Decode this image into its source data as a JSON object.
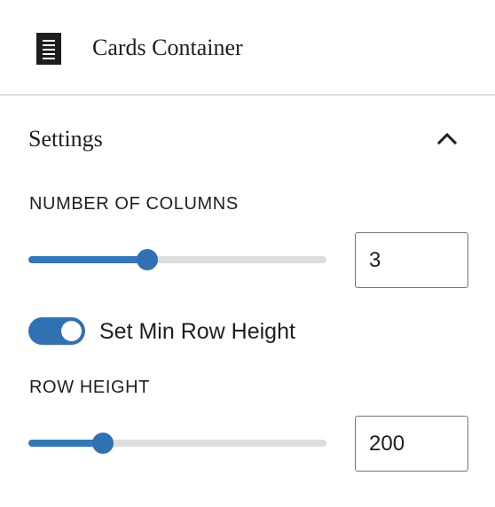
{
  "header": {
    "block_icon": "document-list-icon",
    "title": "Cards Container"
  },
  "panel": {
    "title": "Settings",
    "toggle_icon": "chevron-up-icon",
    "expanded": true
  },
  "columns": {
    "label": "NUMBER OF COLUMNS",
    "value": "3",
    "slider_fraction": 0.4
  },
  "min_row_height": {
    "label": "Set Min Row Height",
    "enabled": true
  },
  "row_height": {
    "label": "ROW HEIGHT",
    "value": "200",
    "slider_fraction": 0.25
  },
  "colors": {
    "accent": "#2f71b3",
    "track": "#dddddd",
    "divider": "#e0e0e0",
    "text": "#1e1e1e"
  }
}
